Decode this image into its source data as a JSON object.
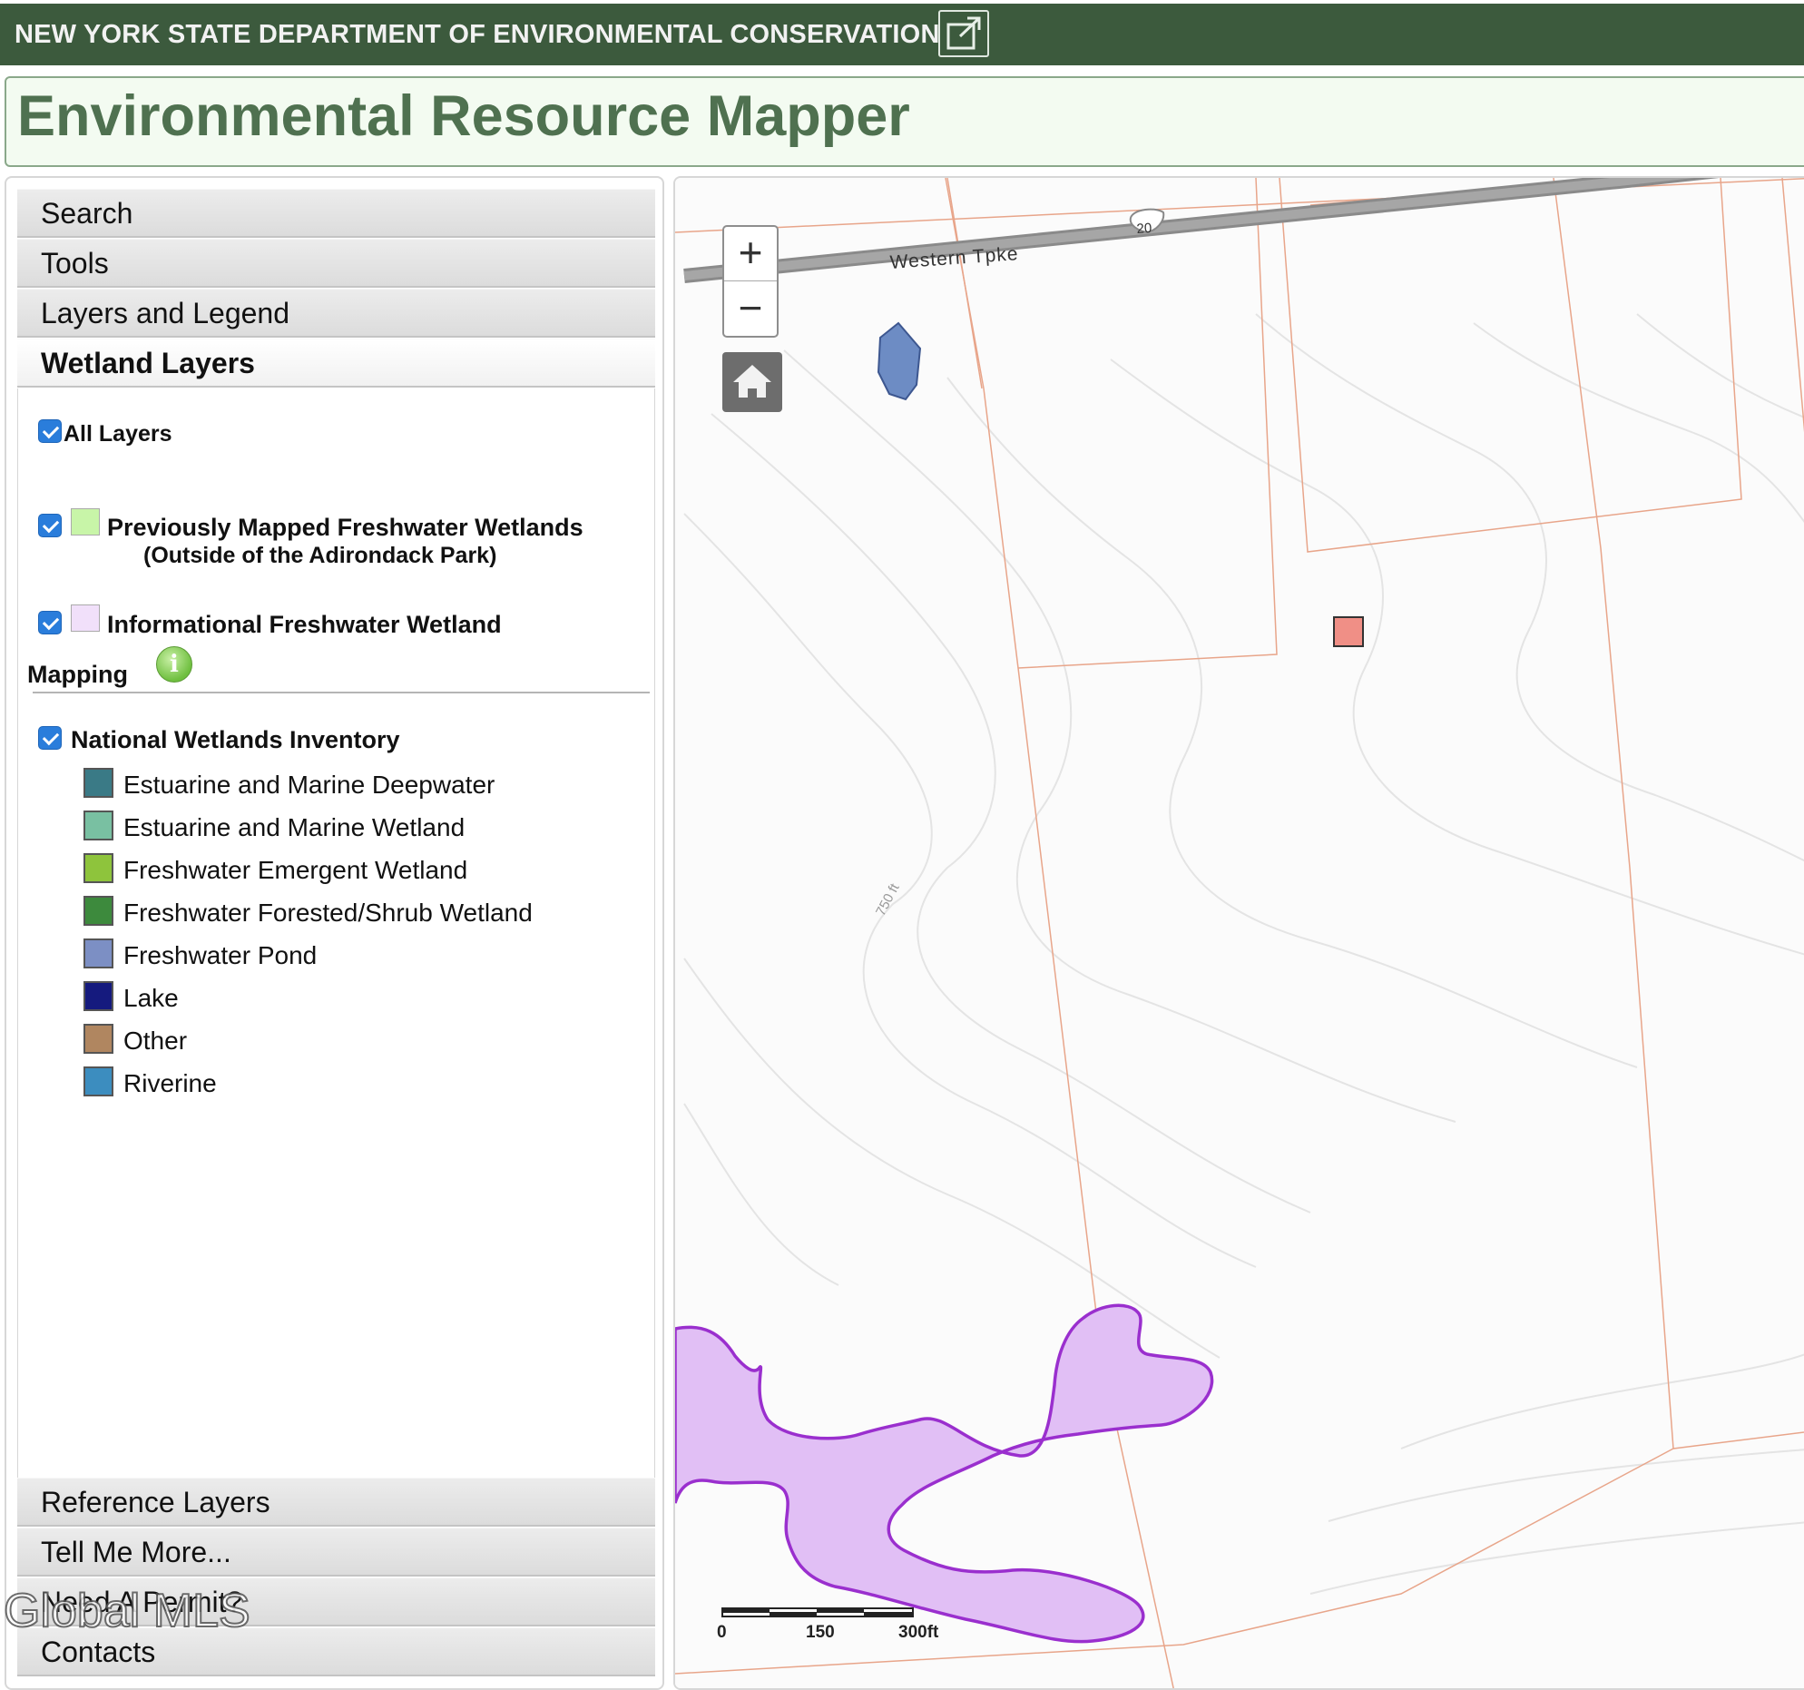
{
  "agency_bar": {
    "name": "NEW YORK STATE DEPARTMENT OF ENVIRONMENTAL CONSERVATION",
    "background": "#3c5a3d"
  },
  "app": {
    "title": "Environmental Resource Mapper",
    "title_color": "#4f7150"
  },
  "side_panel": {
    "sections_top": [
      "Search",
      "Tools",
      "Layers and Legend"
    ],
    "active_section": "Wetland Layers",
    "sections_bottom": [
      "Reference Layers",
      "Tell Me More...",
      "Need A Permit?",
      "Contacts"
    ]
  },
  "wetland_layers": {
    "all_layers": {
      "label": "All Layers",
      "checked": true
    },
    "previously_mapped": {
      "label": "Previously Mapped Freshwater Wetlands",
      "sublabel": "(Outside of the Adirondack Park)",
      "checked": true,
      "swatch_color": "#c8f5a8"
    },
    "informational": {
      "label_line1": "Informational Freshwater Wetland",
      "label_line2": "Mapping",
      "checked": true,
      "swatch_color": "#f1e0fa",
      "info_icon": "info-icon"
    },
    "nwi": {
      "label": "National Wetlands Inventory",
      "checked": true,
      "legend": [
        {
          "label": "Estuarine and Marine Deepwater",
          "color": "#3a7a86"
        },
        {
          "label": "Estuarine and Marine Wetland",
          "color": "#79c0a2"
        },
        {
          "label": "Freshwater Emergent Wetland",
          "color": "#8ec43c"
        },
        {
          "label": "Freshwater Forested/Shrub Wetland",
          "color": "#3d8a3d"
        },
        {
          "label": "Freshwater Pond",
          "color": "#7c8fc4"
        },
        {
          "label": "Lake",
          "color": "#151a7e"
        },
        {
          "label": "Other",
          "color": "#b08660"
        },
        {
          "label": "Riverine",
          "color": "#3c8dbf"
        }
      ]
    }
  },
  "map": {
    "road_name": "Western Tpke",
    "route_shield": "20",
    "contour_label": "750 ft",
    "scale_labels": [
      "0",
      "150",
      "300ft"
    ],
    "zoom_in": "+",
    "zoom_out": "−",
    "home_icon": "home-icon",
    "colors": {
      "parcel_line": "#e8a58a",
      "contour": "#e6e6e6",
      "wetland_fill": "#e1bff5",
      "wetland_outline": "#9a2fce",
      "pond_fill": "#6d8cc4",
      "marker_fill": "#f08f86",
      "road": "#8a8a8a"
    }
  },
  "watermark": "Global MLS"
}
